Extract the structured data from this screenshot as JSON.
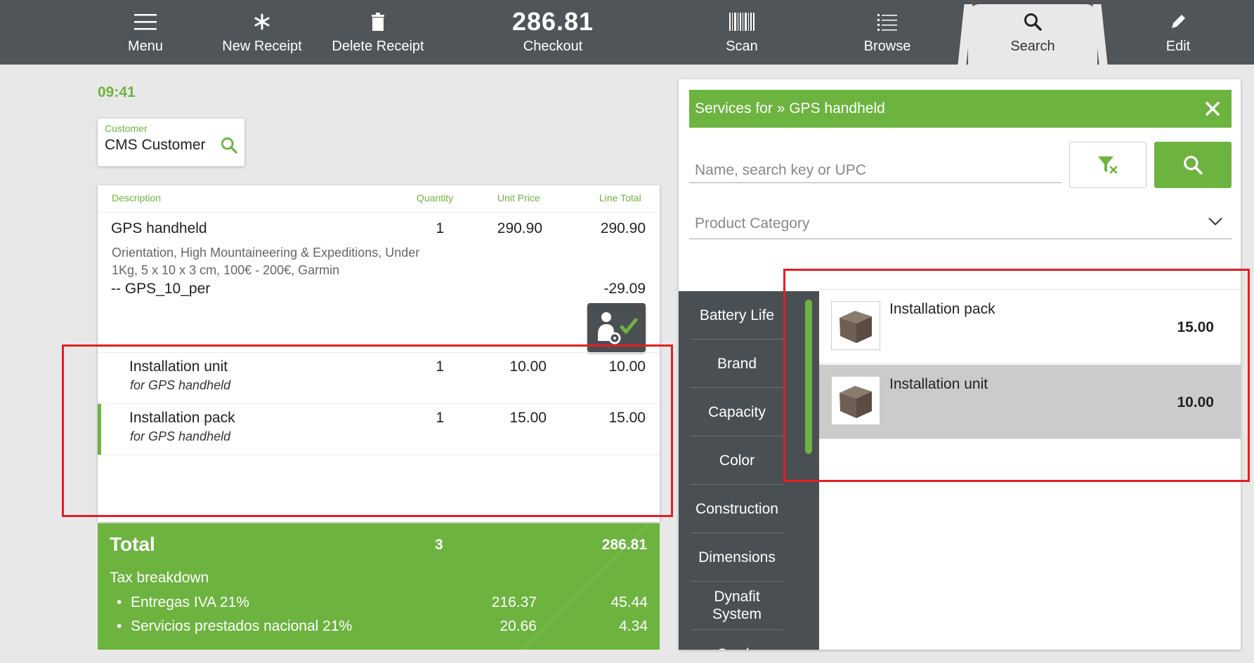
{
  "topbar": {
    "menu_label": "Menu",
    "new_receipt_label": "New Receipt",
    "delete_receipt_label": "Delete Receipt",
    "checkout_amount": "286.81",
    "checkout_label": "Checkout",
    "scan_label": "Scan",
    "browse_label": "Browse",
    "search_label": "Search",
    "edit_label": "Edit"
  },
  "time": "09:41",
  "customer": {
    "label": "Customer",
    "name": "CMS Customer"
  },
  "receipt": {
    "headers": {
      "description": "Description",
      "quantity": "Quantity",
      "unit_price": "Unit Price",
      "line_total": "Line Total"
    },
    "main_item": {
      "name": "GPS handheld",
      "qty": "1",
      "unit_price": "290.90",
      "line_total": "290.90",
      "description": "Orientation, High Mountaineering & Expeditions, Under 1Kg, 5 x 10 x 3 cm, 100€ - 200€, Garmin",
      "discount_name": "-- GPS_10_per",
      "discount_amount": "-29.09"
    },
    "services": [
      {
        "name": "Installation unit",
        "sub": "for GPS handheld",
        "qty": "1",
        "unit_price": "10.00",
        "line_total": "10.00"
      },
      {
        "name": "Installation pack",
        "sub": "for GPS handheld",
        "qty": "1",
        "unit_price": "15.00",
        "line_total": "15.00"
      }
    ]
  },
  "total": {
    "label": "Total",
    "qty": "3",
    "amount": "286.81",
    "tax_header": "Tax breakdown",
    "taxes": [
      {
        "name": "Entregas IVA 21%",
        "base": "216.37",
        "tax": "45.44"
      },
      {
        "name": "Servicios prestados nacional 21%",
        "base": "20.66",
        "tax": "4.34"
      }
    ]
  },
  "panel": {
    "header": "Services for » GPS handheld",
    "search_placeholder": "Name, search key or UPC",
    "category_placeholder": "Product Category",
    "categories": [
      "Battery Life",
      "Brand",
      "Capacity",
      "Color",
      "Construction",
      "Dimensions",
      "Dynafit System",
      "Grade"
    ],
    "results": [
      {
        "name": "Installation pack",
        "price": "15.00"
      },
      {
        "name": "Installation unit",
        "price": "10.00"
      }
    ]
  },
  "colors": {
    "accent": "#6db33f",
    "topbar": "#505559",
    "sidebar": "#4a4f53",
    "highlight": "#e31e24"
  }
}
